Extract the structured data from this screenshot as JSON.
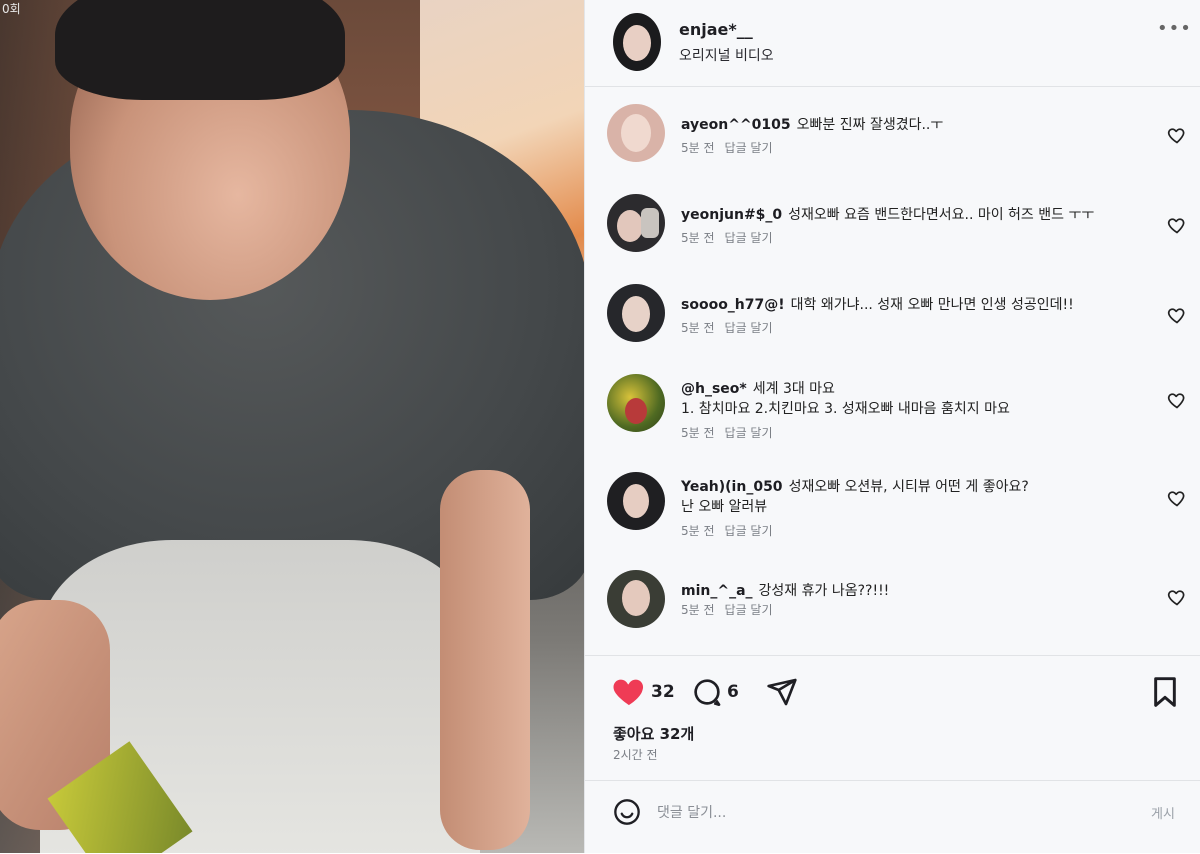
{
  "video": {
    "corner_text": "0회"
  },
  "post": {
    "author": "enjae*__",
    "audio": "오리지널 비디오",
    "more_icon": "more-horizontal-icon"
  },
  "comments": [
    {
      "user": "ayeon^^0105",
      "text": "오빠분 진짜 잘생겼다..ㅜ",
      "time": "5분 전",
      "reply": "답글 달기"
    },
    {
      "user": "yeonjun#$_0",
      "text": "성재오빠 요즘 밴드한다면서요.. 마이 허즈 밴드 ㅜㅜ",
      "time": "5분 전",
      "reply": "답글 달기"
    },
    {
      "user": "soooo_h77@!",
      "text": "대학 왜가냐... 성재 오빠 만나면 인생 성공인데!!",
      "time": "5분 전",
      "reply": "답글 달기"
    },
    {
      "user": "@h_seo*",
      "text": "세계 3대 마요",
      "text2": "1. 참치마요 2.치킨마요 3. 성재오빠 내마음 훔치지 마요",
      "time": "5분 전",
      "reply": "답글 달기"
    },
    {
      "user": "Yeah)(in_050",
      "text": "성재오빠 오션뷰, 시티뷰 어떤 게 좋아요?",
      "text2": "난 오빠 알러뷰",
      "time": "5분 전",
      "reply": "답글 달기"
    },
    {
      "user": "min_^_a_",
      "text": "강성재 휴가 나옴??!!!",
      "time": "5분 전",
      "reply": "답글 달기"
    }
  ],
  "actions": {
    "like_count": "32",
    "comment_count": "6",
    "likes_text": "좋아요 32개",
    "posted": "2시간 전",
    "like_color": "#ef3b55"
  },
  "comment_box": {
    "placeholder": "댓글 달기...",
    "post_label": "게시"
  }
}
